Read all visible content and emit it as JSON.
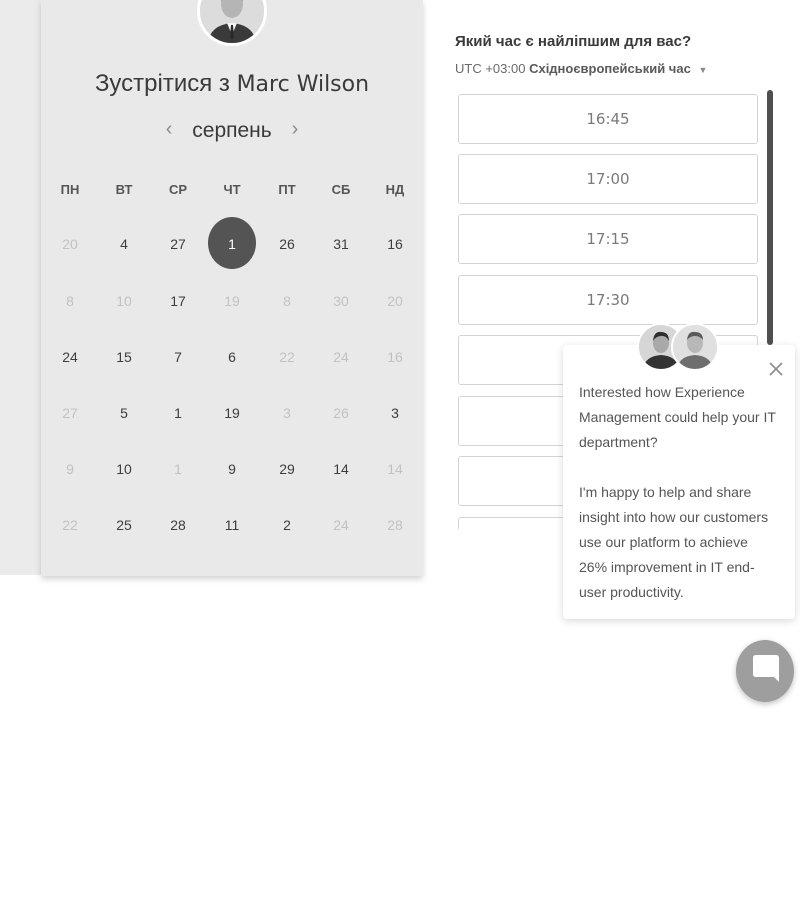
{
  "host": {
    "meet_prefix": "Зустрітися з",
    "name": "Marc Wilson"
  },
  "calendar": {
    "month": "серпень",
    "prev_icon": "chevron-left-icon",
    "next_icon": "chevron-right-icon",
    "weekdays": [
      "ПН",
      "ВТ",
      "СР",
      "ЧТ",
      "ПТ",
      "СБ",
      "НД"
    ],
    "weeks": [
      [
        {
          "d": "20",
          "dim": true
        },
        {
          "d": "4",
          "dim": false
        },
        {
          "d": "27",
          "dim": false
        },
        {
          "d": "1",
          "dim": false,
          "selected": true
        },
        {
          "d": "26",
          "dim": false
        },
        {
          "d": "31",
          "dim": false
        },
        {
          "d": "16",
          "dim": false
        }
      ],
      [
        {
          "d": "8",
          "dim": true
        },
        {
          "d": "10",
          "dim": true
        },
        {
          "d": "17",
          "dim": false
        },
        {
          "d": "19",
          "dim": true
        },
        {
          "d": "8",
          "dim": true
        },
        {
          "d": "30",
          "dim": true
        },
        {
          "d": "20",
          "dim": true
        }
      ],
      [
        {
          "d": "24",
          "dim": false
        },
        {
          "d": "15",
          "dim": false
        },
        {
          "d": "7",
          "dim": false
        },
        {
          "d": "6",
          "dim": false
        },
        {
          "d": "22",
          "dim": true
        },
        {
          "d": "24",
          "dim": true
        },
        {
          "d": "16",
          "dim": true
        }
      ],
      [
        {
          "d": "27",
          "dim": true
        },
        {
          "d": "5",
          "dim": false
        },
        {
          "d": "1",
          "dim": false
        },
        {
          "d": "19",
          "dim": false
        },
        {
          "d": "3",
          "dim": true
        },
        {
          "d": "26",
          "dim": true
        },
        {
          "d": "3",
          "dim": false
        }
      ],
      [
        {
          "d": "9",
          "dim": true
        },
        {
          "d": "10",
          "dim": false
        },
        {
          "d": "1",
          "dim": true
        },
        {
          "d": "9",
          "dim": false
        },
        {
          "d": "29",
          "dim": false
        },
        {
          "d": "14",
          "dim": false
        },
        {
          "d": "14",
          "dim": true
        }
      ],
      [
        {
          "d": "22",
          "dim": true
        },
        {
          "d": "25",
          "dim": false
        },
        {
          "d": "28",
          "dim": false
        },
        {
          "d": "11",
          "dim": false
        },
        {
          "d": "2",
          "dim": false
        },
        {
          "d": "24",
          "dim": true
        },
        {
          "d": "28",
          "dim": true
        }
      ]
    ]
  },
  "times": {
    "question": "Який час є найліпшим для вас?",
    "tz_offset": "UTC +03:00",
    "tz_name": "Східноєвропейський час",
    "tz_icon": "caret-down-icon",
    "slots": [
      "16:45",
      "17:00",
      "17:15",
      "17:30",
      "",
      "",
      ""
    ]
  },
  "chat": {
    "message_1": "Interested how Experience Management could help your IT department?",
    "message_2": "I'm happy to help and share insight into how our customers use our platform to achieve 26% improvement in IT end-user productivity.",
    "close_icon": "close-icon",
    "launcher_icon": "chat-bubble-icon"
  }
}
